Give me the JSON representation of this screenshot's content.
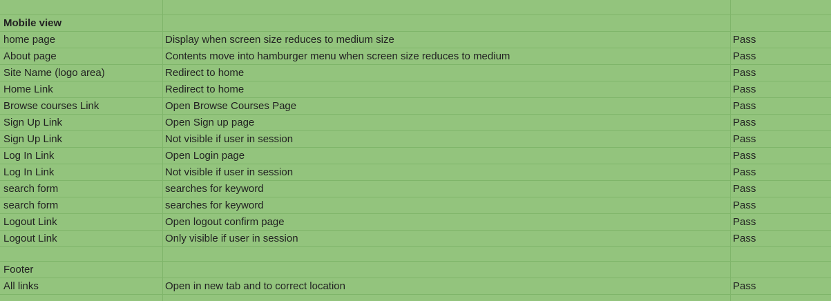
{
  "sheet": {
    "background": "#93c47d",
    "rows": [
      {
        "name": "",
        "description": "",
        "result": "",
        "bold": false
      },
      {
        "name": "Mobile view",
        "description": "",
        "result": "",
        "bold": true
      },
      {
        "name": "home page",
        "description": "Display when screen size reduces to medium size",
        "result": "Pass",
        "bold": false
      },
      {
        "name": "About page",
        "description": "Contents move into hamburger menu when screen size reduces to medium",
        "result": "Pass",
        "bold": false
      },
      {
        "name": "Site Name (logo area)",
        "description": "Redirect to home",
        "result": "Pass",
        "bold": false
      },
      {
        "name": "Home Link",
        "description": "Redirect to home",
        "result": "Pass",
        "bold": false
      },
      {
        "name": "Browse courses Link",
        "description": "Open Browse Courses Page",
        "result": "Pass",
        "bold": false
      },
      {
        "name": "Sign Up Link",
        "description": "Open Sign up page",
        "result": "Pass",
        "bold": false
      },
      {
        "name": "Sign Up Link",
        "description": "Not visible if user in session",
        "result": "Pass",
        "bold": false
      },
      {
        "name": "Log In Link",
        "description": "Open Login page",
        "result": "Pass",
        "bold": false
      },
      {
        "name": "Log In Link",
        "description": "Not visible if user in session",
        "result": "Pass",
        "bold": false
      },
      {
        "name": "search form",
        "description": "searches for keyword",
        "result": "Pass",
        "bold": false
      },
      {
        "name": "search form",
        "description": "searches for keyword",
        "result": "Pass",
        "bold": false
      },
      {
        "name": "Logout Link",
        "description": "Open logout confirm page",
        "result": "Pass",
        "bold": false
      },
      {
        "name": "Logout Link",
        "description": "Only visible if user in session",
        "result": "Pass",
        "bold": false
      },
      {
        "name": "",
        "description": "",
        "result": "",
        "bold": false
      },
      {
        "name": "Footer",
        "description": "",
        "result": "",
        "bold": false
      },
      {
        "name": "All links",
        "description": "Open in new tab and to correct location",
        "result": "Pass",
        "bold": false
      },
      {
        "name": "",
        "description": "",
        "result": "",
        "bold": false
      }
    ]
  }
}
